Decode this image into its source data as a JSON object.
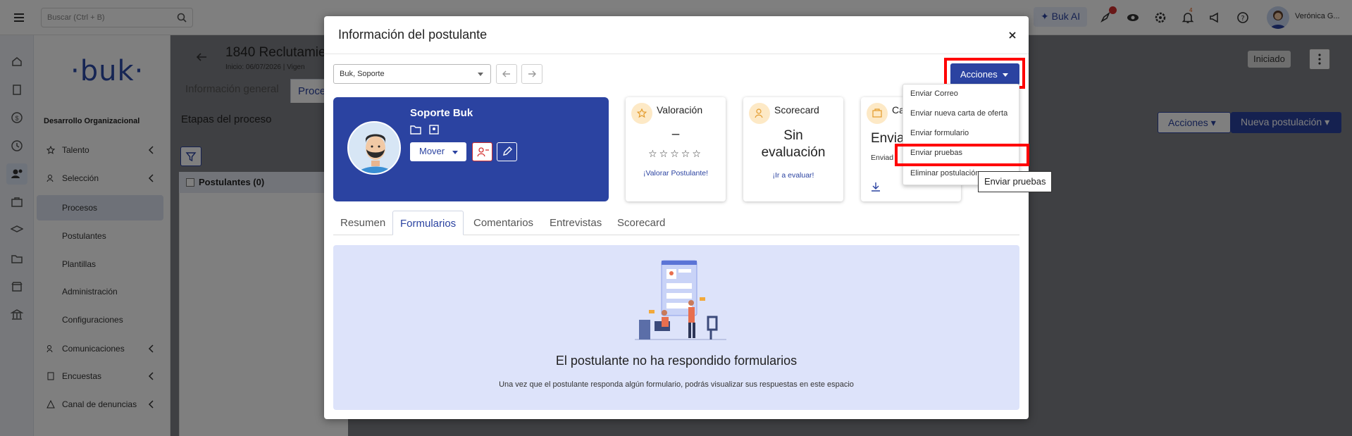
{
  "topbar": {
    "search_placeholder": "Buscar (Ctrl + B)",
    "bukai_label": "Buk AI",
    "notification_count": "4",
    "username": "Verónica G..."
  },
  "sidebar": {
    "logo": "·buk·",
    "section_title": "Desarrollo Organizacional",
    "items": [
      {
        "label": "Talento"
      },
      {
        "label": "Selección"
      },
      {
        "label": "Comunicaciones"
      },
      {
        "label": "Encuestas"
      },
      {
        "label": "Canal de denuncias"
      }
    ],
    "sub_items": [
      {
        "label": "Procesos"
      },
      {
        "label": "Postulantes"
      },
      {
        "label": "Plantillas"
      },
      {
        "label": "Administración"
      },
      {
        "label": "Configuraciones"
      }
    ]
  },
  "background_page": {
    "title": "1840 Reclutamie",
    "subtitle": "Inicio: 06/07/2026  | Vigen",
    "tab_info": "Información general",
    "tab_process": "Proce",
    "stages_title": "Etapas del proceso",
    "postulantes_header": "Postulantes (0)",
    "status": "Iniciado",
    "acciones": "Acciones",
    "nueva_postulacion": "Nueva postulación"
  },
  "modal": {
    "title": "Información del postulante",
    "select_value": "Buk, Soporte",
    "acciones_label": "Acciones",
    "profile": {
      "name": "Soporte Buk",
      "move_label": "Mover"
    },
    "cards": {
      "valoracion": {
        "title": "Valoración",
        "value": "–",
        "link": "¡Valorar Postulante!",
        "stars": "☆☆☆☆☆"
      },
      "scorecard": {
        "title": "Scorecard",
        "value_line1": "Sin",
        "value_line2": "evaluación",
        "link": "¡Ir a evaluar!"
      },
      "carta": {
        "title": "Ca",
        "value": "Envia",
        "sub": "Enviad"
      }
    },
    "tabs": [
      {
        "label": "Resumen"
      },
      {
        "label": "Formularios"
      },
      {
        "label": "Comentarios"
      },
      {
        "label": "Entrevistas"
      },
      {
        "label": "Scorecard"
      }
    ],
    "empty": {
      "title": "El postulante no ha respondido formularios",
      "description": "Una vez que el postulante responda algún formulario, podrás visualizar sus respuestas en este espacio"
    }
  },
  "menu": {
    "items": [
      {
        "label": "Enviar Correo"
      },
      {
        "label": "Enviar nueva carta de oferta"
      },
      {
        "label": "Enviar formulario"
      },
      {
        "label": "Enviar pruebas"
      },
      {
        "label": "Eliminar postulación"
      }
    ],
    "tooltip": "Enviar pruebas"
  },
  "colors": {
    "brand": "#2b43a1",
    "highlight": "#ff0000",
    "empty_bg": "#dde3fa"
  }
}
